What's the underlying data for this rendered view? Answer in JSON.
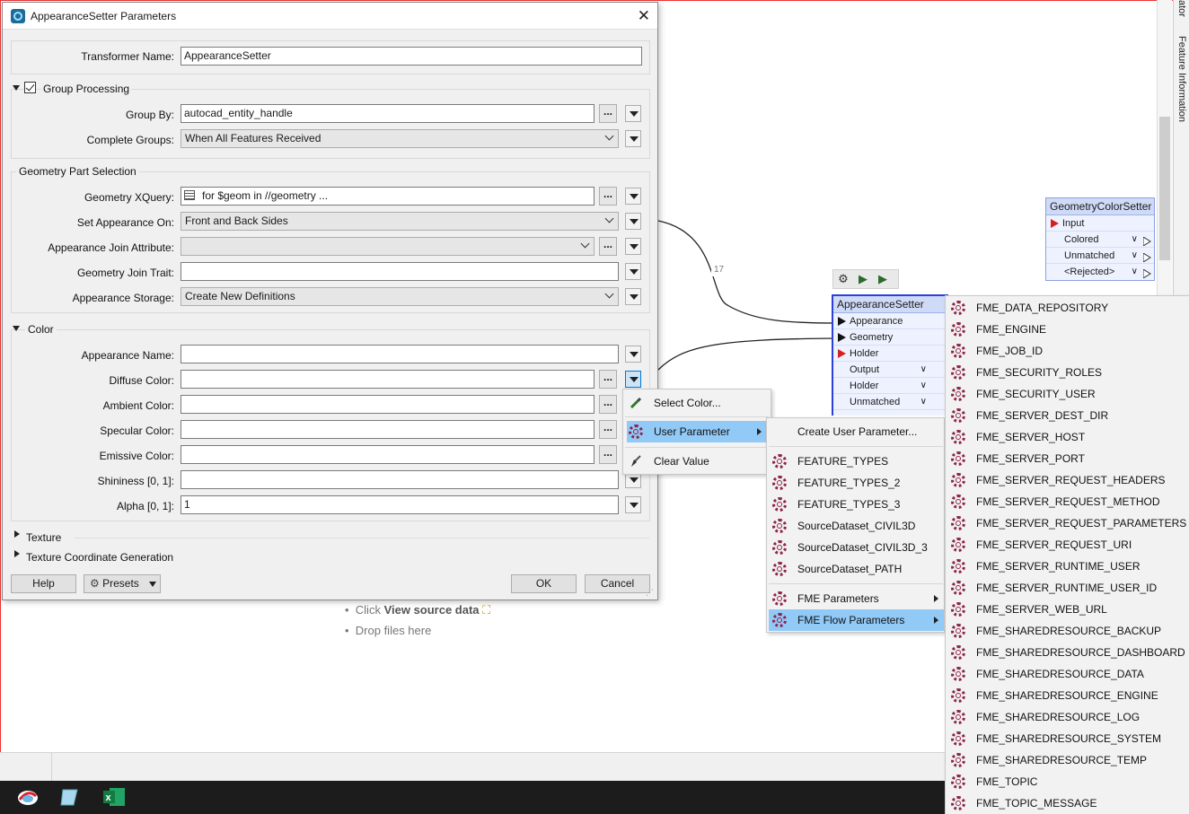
{
  "dialog": {
    "title": "AppearanceSetter Parameters",
    "transformer_name_label": "Transformer Name:",
    "transformer_name_value": "AppearanceSetter",
    "group_processing_label": "Group Processing",
    "group_by_label": "Group By:",
    "group_by_value": "autocad_entity_handle",
    "complete_groups_label": "Complete Groups:",
    "complete_groups_value": "When All Features Received",
    "geometry_part_selection_label": "Geometry Part Selection",
    "geometry_xquery_label": "Geometry XQuery:",
    "geometry_xquery_value": "for $geom in //geometry ...",
    "set_appearance_on_label": "Set Appearance On:",
    "set_appearance_on_value": "Front and Back Sides",
    "appearance_join_attribute_label": "Appearance Join Attribute:",
    "appearance_join_attribute_value": "",
    "geometry_join_trait_label": "Geometry Join Trait:",
    "geometry_join_trait_value": "",
    "appearance_storage_label": "Appearance Storage:",
    "appearance_storage_value": "Create New Definitions",
    "color_section_label": "Color",
    "appearance_name_label": "Appearance Name:",
    "diffuse_color_label": "Diffuse Color:",
    "ambient_color_label": "Ambient Color:",
    "specular_color_label": "Specular Color:",
    "emissive_color_label": "Emissive Color:",
    "shininess_label": "Shininess [0, 1]:",
    "alpha_label": "Alpha [0, 1]:",
    "alpha_value": "1",
    "texture_label": "Texture",
    "texture_coord_label": "Texture Coordinate Generation",
    "help_button": "Help",
    "presets_button": "Presets",
    "ok_button": "OK",
    "cancel_button": "Cancel",
    "dots": "..."
  },
  "context_menu": {
    "select_color": "Select Color...",
    "user_parameter": "User Parameter",
    "clear_value": "Clear Value"
  },
  "user_param_menu": {
    "create": "Create User Parameter...",
    "items": [
      "FEATURE_TYPES",
      "FEATURE_TYPES_2",
      "FEATURE_TYPES_3",
      "SourceDataset_CIVIL3D",
      "SourceDataset_CIVIL3D_3",
      "SourceDataset_PATH"
    ],
    "fme_parameters": "FME Parameters",
    "fme_flow_parameters": "FME Flow Parameters"
  },
  "flow_params_menu": {
    "items": [
      "FME_DATA_REPOSITORY",
      "FME_ENGINE",
      "FME_JOB_ID",
      "FME_SECURITY_ROLES",
      "FME_SECURITY_USER",
      "FME_SERVER_DEST_DIR",
      "FME_SERVER_HOST",
      "FME_SERVER_PORT",
      "FME_SERVER_REQUEST_HEADERS",
      "FME_SERVER_REQUEST_METHOD",
      "FME_SERVER_REQUEST_PARAMETERS",
      "FME_SERVER_REQUEST_URI",
      "FME_SERVER_RUNTIME_USER",
      "FME_SERVER_RUNTIME_USER_ID",
      "FME_SERVER_WEB_URL",
      "FME_SHAREDRESOURCE_BACKUP",
      "FME_SHAREDRESOURCE_DASHBOARD",
      "FME_SHAREDRESOURCE_DATA",
      "FME_SHAREDRESOURCE_ENGINE",
      "FME_SHAREDRESOURCE_LOG",
      "FME_SHAREDRESOURCE_SYSTEM",
      "FME_SHAREDRESOURCE_TEMP",
      "FME_TOPIC",
      "FME_TOPIC_MESSAGE"
    ]
  },
  "canvas": {
    "connection_count": "17",
    "hint_click": "Click ",
    "hint_view_source": "View source data",
    "hint_drop": "Drop files here",
    "right_panel_tab": "Feature Information",
    "right_panel_tab_cut": "ator"
  },
  "appearance_setter_node": {
    "title": "AppearanceSetter",
    "ports": [
      "Appearance",
      "Geometry",
      "Holder",
      "Output",
      "Holder",
      "Unmatched"
    ]
  },
  "geometry_color_setter_node": {
    "title": "GeometryColorSetter",
    "ports": [
      "Input",
      "Colored",
      "Unmatched",
      "<Rejected>"
    ]
  },
  "colors": {
    "menu_highlight": "#91c9f7",
    "gear_icon": "#8d2448",
    "node_header": "#cfdaf7",
    "selected_node_border": "#2c3fd6"
  }
}
